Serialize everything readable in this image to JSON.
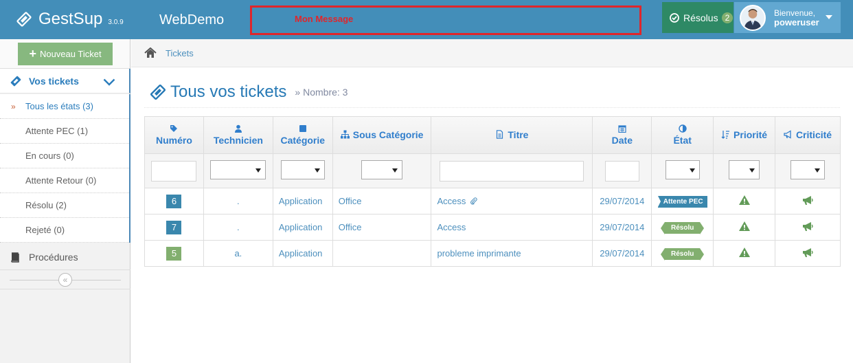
{
  "navbar": {
    "brand": "GestSup",
    "version": "3.0.9",
    "company": "WebDemo",
    "message": "Mon Message",
    "resolved_label": "Résolus",
    "resolved_count": "2",
    "welcome": "Bienvenue,",
    "username": "poweruser",
    "colors": {
      "navbar": "#438eb9",
      "resolved": "#2e8965",
      "user": "#62a8d1",
      "message_border": "#e0262b"
    }
  },
  "sidebar": {
    "new_ticket": "Nouveau Ticket",
    "main_item": "Vos tickets",
    "items": [
      {
        "label": "Tous les états (3)"
      },
      {
        "label": "Attente PEC (1)"
      },
      {
        "label": "En cours (0)"
      },
      {
        "label": "Attente Retour (0)"
      },
      {
        "label": "Résolu (2)"
      },
      {
        "label": "Rejeté (0)"
      }
    ],
    "procedures": "Procédures",
    "collapse_icon": "double-chevron-left-icon"
  },
  "breadcrumb": {
    "item": "Tickets"
  },
  "header": {
    "title": "Tous vos tickets",
    "subtitle": "Nombre: 3"
  },
  "table": {
    "columns": [
      {
        "label": "Numéro",
        "icon": "tag-icon"
      },
      {
        "label": "Technicien",
        "icon": "user-icon"
      },
      {
        "label": "Catégorie",
        "icon": "square-icon"
      },
      {
        "label": "Sous Catégorie",
        "icon": "sitemap-icon"
      },
      {
        "label": "Titre",
        "icon": "file-icon"
      },
      {
        "label": "Date",
        "icon": "calendar-icon"
      },
      {
        "label": "État",
        "icon": "adjust-icon"
      },
      {
        "label": "Priorité",
        "icon": "sort-icon"
      },
      {
        "label": "Criticité",
        "icon": "bullhorn-icon"
      }
    ],
    "rows": [
      {
        "number": "6",
        "technician": ".",
        "category": "Application",
        "subcategory": "Office",
        "title": "Access",
        "date": "29/07/2014",
        "state": "Attente PEC"
      },
      {
        "number": "7",
        "technician": ".",
        "category": "Application",
        "subcategory": "Office",
        "title": "Access",
        "date": "29/07/2014",
        "state": "Résolu"
      },
      {
        "number": "5",
        "technician": "a.",
        "category": "Application",
        "subcategory": "",
        "title": "probleme imprimante",
        "date": "29/07/2014",
        "state": "Résolu"
      }
    ]
  }
}
